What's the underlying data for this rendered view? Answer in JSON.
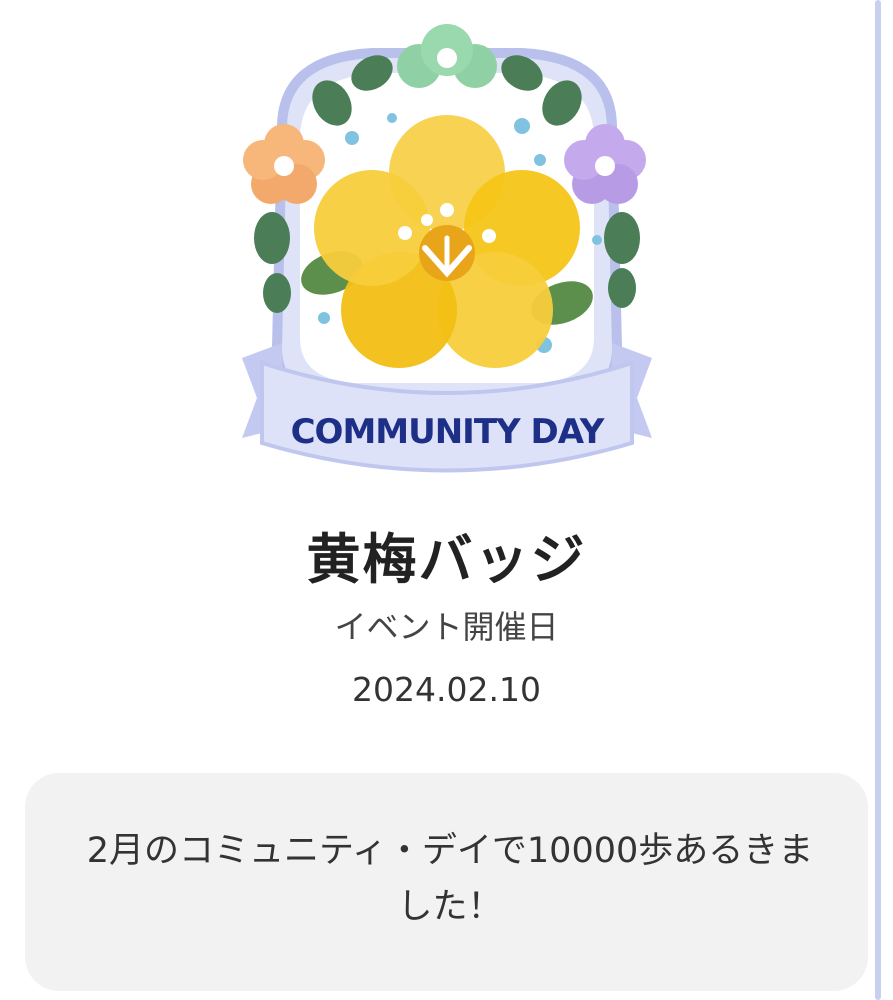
{
  "badge": {
    "banner_text": "COMMUNITY DAY",
    "name": "黄梅バッジ",
    "icon": "yellow-plum-flower-badge"
  },
  "event": {
    "label": "イベント開催日",
    "date": "2024.02.10"
  },
  "description": "2月のコミュニティ・デイで10000歩あるきました！",
  "colors": {
    "title": "#222222",
    "panel": "#f2f2f2",
    "banner_text": "#1d2f86",
    "flower": "#f5c518",
    "scrollbar": "#c7d0ef"
  }
}
